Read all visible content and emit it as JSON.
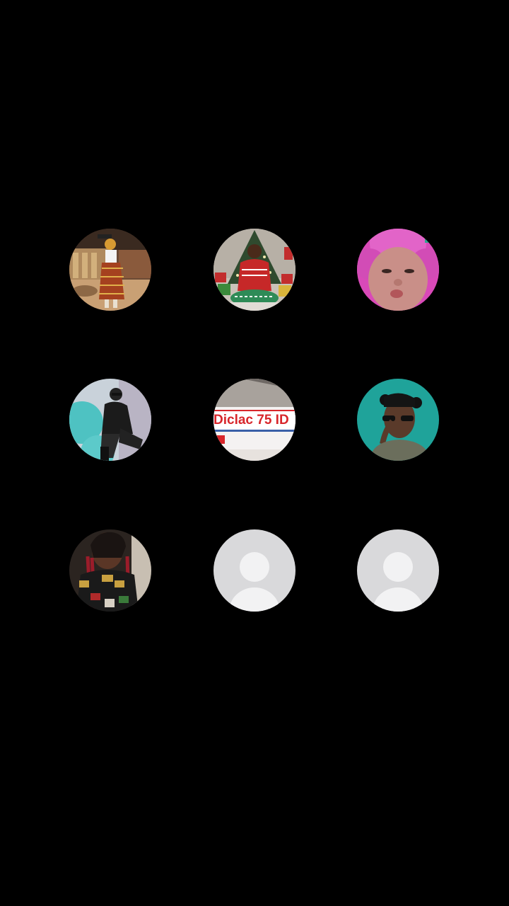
{
  "contacts": [
    {
      "type": "photo",
      "icon": "person-photo-restaurant"
    },
    {
      "type": "photo",
      "icon": "person-photo-christmas-tree"
    },
    {
      "type": "photo",
      "icon": "person-photo-pink-hair"
    },
    {
      "type": "photo",
      "icon": "person-photo-teal-backdrop"
    },
    {
      "type": "photo",
      "icon": "medicine-box-photo",
      "label": "Diclac 75 ID"
    },
    {
      "type": "photo",
      "icon": "person-photo-sunglasses"
    },
    {
      "type": "photo",
      "icon": "person-photo-patterned-outfit"
    },
    {
      "type": "placeholder",
      "icon": "default-avatar-icon"
    },
    {
      "type": "placeholder",
      "icon": "default-avatar-icon"
    }
  ],
  "colors": {
    "background": "#000000",
    "placeholder_bg": "#d9d9db",
    "placeholder_fg": "#f2f2f3",
    "label_red": "#d8262b"
  }
}
